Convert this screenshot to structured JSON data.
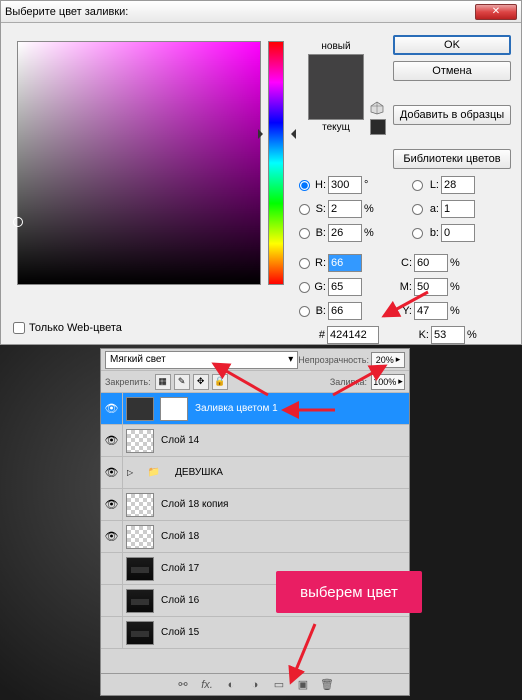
{
  "dialog": {
    "title": "Выберите цвет заливки:",
    "new_label": "новый",
    "current_label": "текущ",
    "buttons": {
      "ok": "OK",
      "cancel": "Отмена",
      "add_swatch": "Добавить в образцы",
      "libraries": "Библиотеки цветов"
    },
    "web_only": "Только Web-цвета",
    "inputs": {
      "H": {
        "label": "H:",
        "value": "300",
        "unit": "°"
      },
      "S": {
        "label": "S:",
        "value": "2",
        "unit": "%"
      },
      "Bv": {
        "label": "B:",
        "value": "26",
        "unit": "%"
      },
      "R": {
        "label": "R:",
        "value": "66"
      },
      "G": {
        "label": "G:",
        "value": "65"
      },
      "B2": {
        "label": "B:",
        "value": "66"
      },
      "L": {
        "label": "L:",
        "value": "28"
      },
      "a": {
        "label": "a:",
        "value": "1"
      },
      "b": {
        "label": "b:",
        "value": "0"
      },
      "C": {
        "label": "C:",
        "value": "60",
        "unit": "%"
      },
      "M": {
        "label": "M:",
        "value": "50",
        "unit": "%"
      },
      "Y": {
        "label": "Y:",
        "value": "47",
        "unit": "%"
      },
      "K": {
        "label": "K:",
        "value": "53",
        "unit": "%"
      },
      "hex": {
        "label": "#",
        "value": "424142"
      }
    }
  },
  "layers": {
    "blend_mode": "Мягкий свет",
    "opacity_label": "Непрозрачность:",
    "opacity_value": "20%",
    "lock_label": "Закрепить:",
    "fill_label": "Заливка:",
    "fill_value": "100%",
    "items": [
      {
        "name": "Заливка цветом 1",
        "selected": true,
        "type": "fill"
      },
      {
        "name": "Слой 14",
        "type": "normal"
      },
      {
        "name": "ДЕВУШКА",
        "type": "group"
      },
      {
        "name": "Слой 18 копия",
        "type": "normal"
      },
      {
        "name": "Слой 18",
        "type": "normal"
      },
      {
        "name": "Слой 17",
        "type": "strip"
      },
      {
        "name": "Слой 16",
        "type": "strip"
      },
      {
        "name": "Слой 15",
        "type": "strip"
      }
    ]
  },
  "callout": "выберем цвет",
  "colors": {
    "accent_red": "#e91e63",
    "selection_blue": "#1e90ff",
    "swatch": "#424142"
  }
}
